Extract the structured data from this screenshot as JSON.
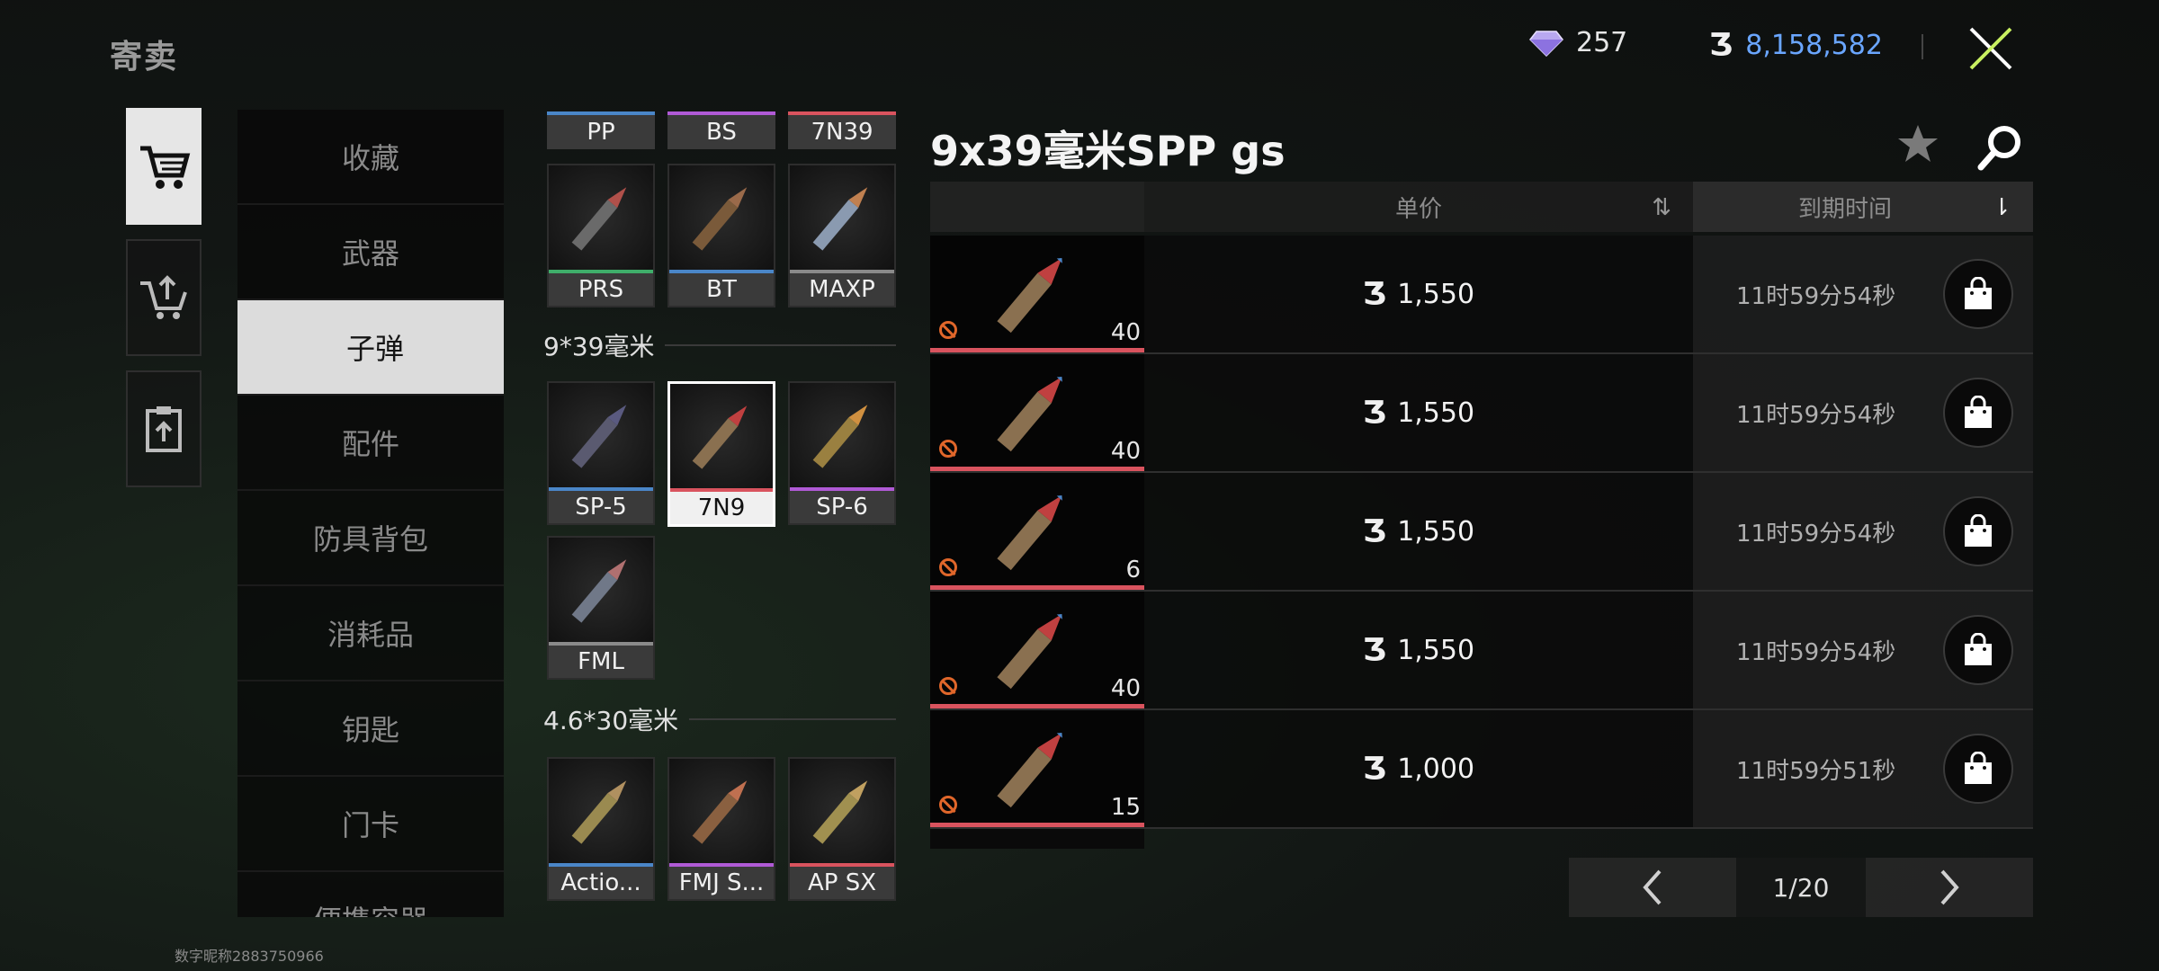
{
  "header": {
    "title": "寄卖",
    "gems": "257",
    "money": "8,158,582"
  },
  "categories": [
    "收藏",
    "武器",
    "子弹",
    "配件",
    "防具背包",
    "消耗品",
    "钥匙",
    "门卡",
    "便携容器"
  ],
  "ammo": {
    "top_chips": [
      "PP",
      "BS",
      "7N39"
    ],
    "top_cards": [
      "PRS",
      "BT",
      "MAXP"
    ],
    "section1": "9*39毫米",
    "section1_cards": [
      "SP-5",
      "7N9",
      "SP-6",
      "FML"
    ],
    "section2": "4.6*30毫米",
    "section2_cards": [
      "Actio...",
      "FMJ S...",
      "AP SX"
    ]
  },
  "listing": {
    "title": "9x39毫米SPP  gs",
    "col_price": "单价",
    "col_expiry": "到期时间",
    "rows": [
      {
        "price": "1,550",
        "expiry": "11时59分54秒",
        "qty": "40"
      },
      {
        "price": "1,550",
        "expiry": "11时59分54秒",
        "qty": "40"
      },
      {
        "price": "1,550",
        "expiry": "11时59分54秒",
        "qty": "6"
      },
      {
        "price": "1,550",
        "expiry": "11时59分54秒",
        "qty": "40"
      },
      {
        "price": "1,000",
        "expiry": "11时59分51秒",
        "qty": "15"
      }
    ]
  },
  "pager": {
    "page": "1/20"
  },
  "footer": {
    "user_id": "数字昵称2883750966"
  },
  "colors": {
    "money": "#6aa6ff",
    "rarity_red": "#d9535e",
    "rarity_blue": "#4a86c8",
    "rarity_purple": "#b05ad6",
    "rarity_green": "#3fae6a",
    "rarity_gray": "#8a8a8a"
  }
}
